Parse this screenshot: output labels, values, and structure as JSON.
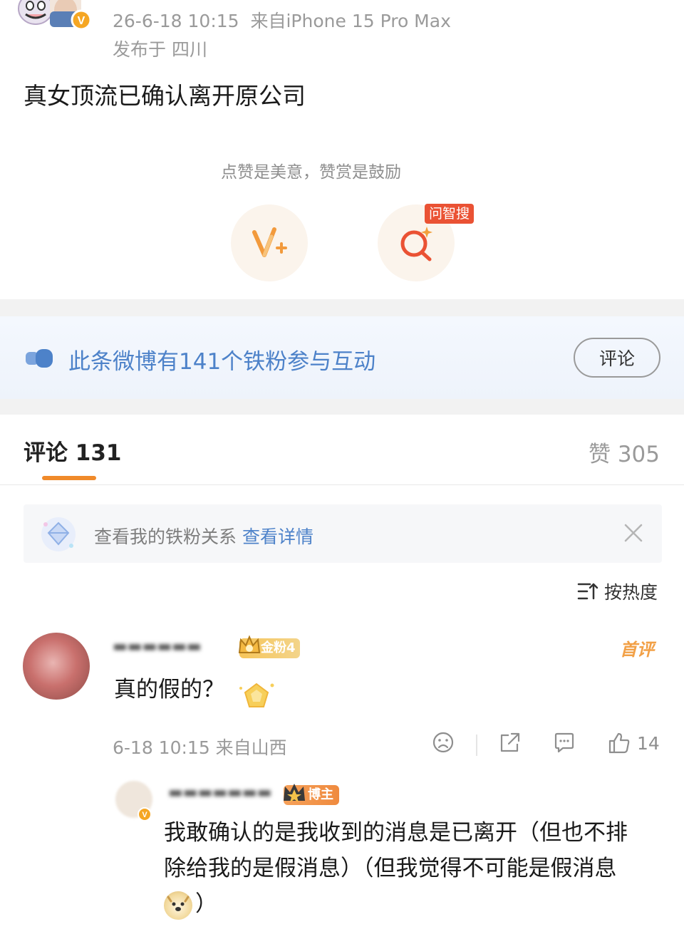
{
  "post": {
    "timestamp": "26-6-18 10:15",
    "source": "来自iPhone 15 Pro Max",
    "location": "发布于 四川",
    "text": "真女顶流已确认离开原公司"
  },
  "reward": {
    "hint": "点赞是美意，赞赏是鼓励",
    "ai_search_badge": "问智搜"
  },
  "fans_banner": {
    "text": "此条微博有141个铁粉参与互动",
    "comment_button": "评论"
  },
  "tabs": {
    "comments_label": "评论 131",
    "likes_label": "赞 305"
  },
  "notice": {
    "text": "查看我的铁粉关系",
    "link": "查看详情"
  },
  "sort": {
    "label": "按热度"
  },
  "comment": {
    "badge": "金粉4",
    "first_tag": "首评",
    "text": "真的假的？",
    "meta": "6-18 10:15  来自山西",
    "like_count": "14"
  },
  "reply": {
    "badge": "博主",
    "text_line1": "我敢确认的是我收到的消息是已离开（但也不排",
    "text_line2": "除给我的是假消息）（但我觉得不可能是假消息",
    "text_end": "）"
  },
  "colors": {
    "link_blue": "#4d82c9",
    "accent_orange": "#f08a2a",
    "badge_red": "#ea5234"
  }
}
